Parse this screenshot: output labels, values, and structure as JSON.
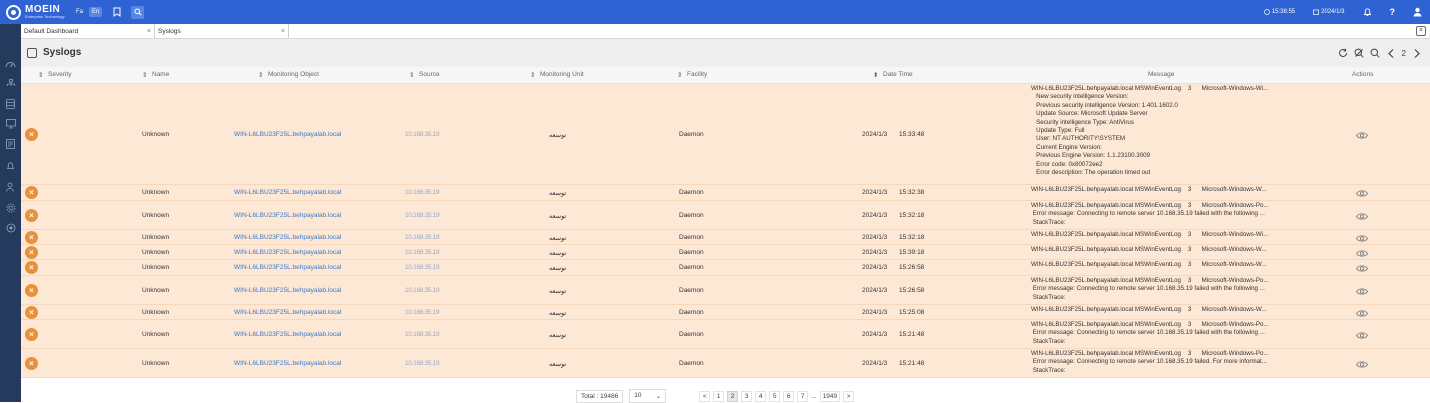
{
  "topbar": {
    "logo_name": "MOEIN",
    "logo_sub": "Enterprise Technology",
    "lang_fa": "Fa",
    "lang_en": "En",
    "time": "15:38:55",
    "date": "2024/1/3",
    "help": "?"
  },
  "tabs": [
    {
      "label": "Default Dashboard",
      "close": "×"
    },
    {
      "label": "Syslogs",
      "close": "×"
    }
  ],
  "close_all": "×",
  "page": {
    "title": "Syslogs",
    "page_indicator": "2"
  },
  "columns": {
    "severity": "Severity",
    "name": "Name",
    "monitoring_object": "Monitoring Object",
    "source": "Source",
    "monitoring_unit": "Monitoring Unit",
    "facility": "Facility",
    "date_time": "Date Time",
    "message": "Message",
    "actions": "Actions"
  },
  "rows": [
    {
      "severity": "×",
      "name": "Unknown",
      "object": "WIN-L6LBU23F25L.behpayalab.local",
      "source": "10.168.35.19",
      "unit": "توسعه",
      "facility": "Daemon",
      "date": "2024/1/3",
      "time": "15:33:48",
      "message": "WIN-L6LBU23F25L.behpayalab.local MSWinEventLog    3      Microsoft-Windows-Wi...\n   New security intelligence Version:\n   Previous security intelligence Version: 1.401.1602.0\n   Update Source: Microsoft Update Server\n   Security intelligence Type: AntiVirus\n   Update Type: Full\n   User: NT AUTHORITY\\SYSTEM\n   Current Engine Version:\n   Previous Engine Version: 1.1.23100.3009\n   Error code: 0x80072ee2\n   Error description: The operation timed out"
    },
    {
      "severity": "×",
      "name": "Unknown",
      "object": "WIN-L6LBU23F25L.behpayalab.local",
      "source": "10.168.35.19",
      "unit": "توسعه",
      "facility": "Daemon",
      "date": "2024/1/3",
      "time": "15:32:38",
      "message": "WIN-L6LBU23F25L.behpayalab.local MSWinEventLog    3      Microsoft-Windows-W..."
    },
    {
      "severity": "×",
      "name": "Unknown",
      "object": "WIN-L6LBU23F25L.behpayalab.local",
      "source": "10.168.35.19",
      "unit": "توسعه",
      "facility": "Daemon",
      "date": "2024/1/3",
      "time": "15:32:18",
      "message": "WIN-L6LBU23F25L.behpayalab.local MSWinEventLog    3      Microsoft-Windows-Po...\n Error message: Connecting to remote server 10.168.35.19 failed with the following ...\n StackTrace:"
    },
    {
      "severity": "×",
      "name": "Unknown",
      "object": "WIN-L6LBU23F25L.behpayalab.local",
      "source": "10.168.35.19",
      "unit": "توسعه",
      "facility": "Daemon",
      "date": "2024/1/3",
      "time": "15:32:18",
      "message": "WIN-L6LBU23F25L.behpayalab.local MSWinEventLog    3      Microsoft-Windows-Wi..."
    },
    {
      "severity": "×",
      "name": "Unknown",
      "object": "WIN-L6LBU23F25L.behpayalab.local",
      "source": "10.168.35.19",
      "unit": "توسعه",
      "facility": "Daemon",
      "date": "2024/1/3",
      "time": "15:39:18",
      "message": "WIN-L6LBU23F25L.behpayalab.local MSWinEventLog    3      Microsoft-Windows-W..."
    },
    {
      "severity": "×",
      "name": "Unknown",
      "object": "WIN-L6LBU23F25L.behpayalab.local",
      "source": "10.168.35.19",
      "unit": "توسعه",
      "facility": "Daemon",
      "date": "2024/1/3",
      "time": "15:26:58",
      "message": "WIN-L6LBU23F25L.behpayalab.local MSWinEventLog    3      Microsoft-Windows-W..."
    },
    {
      "severity": "×",
      "name": "Unknown",
      "object": "WIN-L6LBU23F25L.behpayalab.local",
      "source": "10.168.35.19",
      "unit": "توسعه",
      "facility": "Daemon",
      "date": "2024/1/3",
      "time": "15:26:58",
      "message": "WIN-L6LBU23F25L.behpayalab.local MSWinEventLog    3      Microsoft-Windows-Po...\n Error message: Connecting to remote server 10.168.35.19 failed with the following ...\n StackTrace:"
    },
    {
      "severity": "×",
      "name": "Unknown",
      "object": "WIN-L6LBU23F25L.behpayalab.local",
      "source": "10.168.35.19",
      "unit": "توسعه",
      "facility": "Daemon",
      "date": "2024/1/3",
      "time": "15:25:08",
      "message": "WIN-L6LBU23F25L.behpayalab.local MSWinEventLog    3      Microsoft-Windows-W..."
    },
    {
      "severity": "×",
      "name": "Unknown",
      "object": "WIN-L6LBU23F25L.behpayalab.local",
      "source": "10.168.35.19",
      "unit": "توسعه",
      "facility": "Daemon",
      "date": "2024/1/3",
      "time": "15:21:48",
      "message": "WIN-L6LBU23F25L.behpayalab.local MSWinEventLog    3      Microsoft-Windows-Po...\n Error message: Connecting to remote server 10.168.35.19 failed with the following ...\n StackTrace:"
    },
    {
      "severity": "×",
      "name": "Unknown",
      "object": "WIN-L6LBU23F25L.behpayalab.local",
      "source": "10.168.35.19",
      "unit": "توسعه",
      "facility": "Daemon",
      "date": "2024/1/3",
      "time": "15:21:48",
      "message": "WIN-L6LBU23F25L.behpayalab.local MSWinEventLog    3      Microsoft-Windows-Po...\n Error message: Connecting to remote server 10.168.35.19 failed. For more informat...\n StackTrace:"
    }
  ],
  "pagination": {
    "total_label": "Total :",
    "total": "19486",
    "page_size": "10",
    "page_size_arrow": "⌄",
    "prev": "<",
    "pages": [
      "1",
      "2",
      "3",
      "4",
      "5",
      "6",
      "7"
    ],
    "ellipsis": "...",
    "last": "1949",
    "next": ">"
  },
  "colors": {
    "topbar": "#2f63d4",
    "sidebar": "#253a5c",
    "row_bg": "#fde8d6",
    "severity": "#e8913a",
    "link": "#3a78c9"
  }
}
